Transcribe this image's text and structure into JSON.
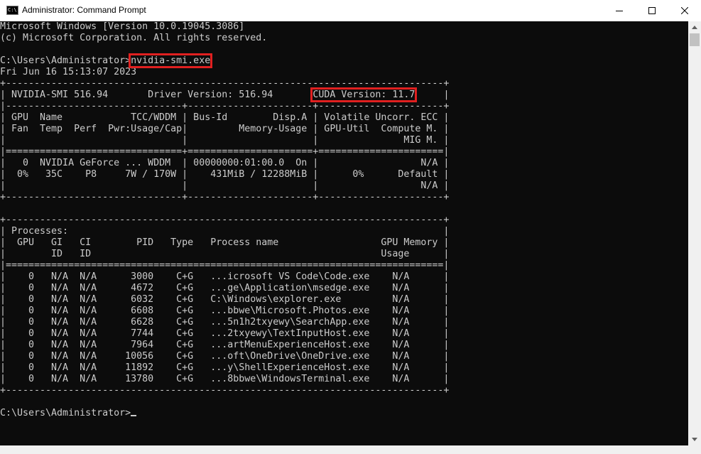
{
  "window": {
    "title": "Administrator: Command Prompt",
    "icon_label": "C:\\",
    "controls": {
      "minimize_icon": "minimize-icon",
      "maximize_icon": "maximize-icon",
      "close_icon": "close-icon"
    }
  },
  "console": {
    "banner": [
      "Microsoft Windows [Version 10.0.19045.3086]",
      "(c) Microsoft Corporation. All rights reserved."
    ],
    "command_prompt": "C:\\Users\\Administrator>",
    "command": "nvidia-smi.exe",
    "timestamp": "Fri Jun 16 15:13:07 2023",
    "smi_header": {
      "border_top": "+-----------------------------------------------------------------------------+",
      "version_left": "| NVIDIA-SMI 516.94       Driver Version: 516.94       ",
      "cuda_version": "CUDA Version: 11.7",
      "version_right": "     |",
      "border_mid": "|-------------------------------+----------------------+----------------------+",
      "columns": [
        "| GPU  Name            TCC/WDDM | Bus-Id        Disp.A | Volatile Uncorr. ECC |",
        "| Fan  Temp  Perf  Pwr:Usage/Cap|         Memory-Usage | GPU-Util  Compute M. |",
        "|                               |                      |               MIG M. |"
      ],
      "border_sep": "|===============================+======================+======================|",
      "gpu_rows": [
        "|   0  NVIDIA GeForce ... WDDM  | 00000000:01:00.0  On |                  N/A |",
        "|  0%   35C    P8     7W / 170W |    431MiB / 12288MiB |      0%      Default |",
        "|                               |                      |                  N/A |"
      ],
      "border_bottom": "+-------------------------------+----------------------+----------------------+"
    },
    "processes": {
      "border_top": "+-----------------------------------------------------------------------------+",
      "header": [
        "| Processes:                                                                  |",
        "|  GPU   GI   CI        PID   Type   Process name                  GPU Memory |",
        "|        ID   ID                                                   Usage      |"
      ],
      "border_sep": "|=============================================================================|",
      "rows": [
        "|    0   N/A  N/A      3000    C+G   ...icrosoft VS Code\\Code.exe    N/A      |",
        "|    0   N/A  N/A      4672    C+G   ...ge\\Application\\msedge.exe    N/A      |",
        "|    0   N/A  N/A      6032    C+G   C:\\Windows\\explorer.exe         N/A      |",
        "|    0   N/A  N/A      6608    C+G   ...bbwe\\Microsoft.Photos.exe    N/A      |",
        "|    0   N/A  N/A      6628    C+G   ...5n1h2txyewy\\SearchApp.exe    N/A      |",
        "|    0   N/A  N/A      7744    C+G   ...2txyewy\\TextInputHost.exe    N/A      |",
        "|    0   N/A  N/A      7964    C+G   ...artMenuExperienceHost.exe    N/A      |",
        "|    0   N/A  N/A     10056    C+G   ...oft\\OneDrive\\OneDrive.exe    N/A      |",
        "|    0   N/A  N/A     11892    C+G   ...y\\ShellExperienceHost.exe    N/A      |",
        "|    0   N/A  N/A     13780    C+G   ...8bbwe\\WindowsTerminal.exe    N/A      |"
      ],
      "border_bottom": "+-----------------------------------------------------------------------------+"
    },
    "final_prompt": "C:\\Users\\Administrator>"
  },
  "colors": {
    "console_bg": "#0c0c0c",
    "console_text": "#cccccc",
    "highlight": "#e02020",
    "titlebar_bg": "#ffffff"
  }
}
